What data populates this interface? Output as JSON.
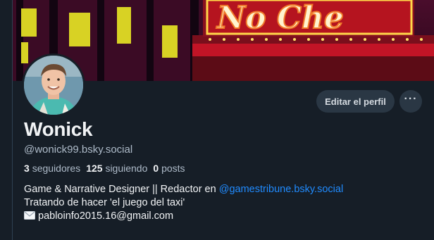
{
  "profile": {
    "display_name": "Wonick",
    "handle": "@wonick99.bsky.social",
    "edit_button": "Editar el perfil",
    "more_button": "···"
  },
  "stats": {
    "followers_count": "3",
    "followers_label": "seguidores",
    "following_count": "125",
    "following_label": "siguiendo",
    "posts_count": "0",
    "posts_label": "posts"
  },
  "bio": {
    "line1_text": "Game & Narrative Designer || Redactor en ",
    "line1_link": "@gamestribune.bsky.social",
    "line2": "Tratando de hacer 'el juego del taxi'",
    "line3_email": "pabloinfo2015.16@gmail.com",
    "line3_icon": "envelope-icon"
  },
  "banner": {
    "sign_text": "No Che"
  },
  "colors": {
    "background": "#161e27",
    "link": "#208bfe",
    "button_bg": "#2a3744",
    "muted_text": "#aebbc9"
  }
}
